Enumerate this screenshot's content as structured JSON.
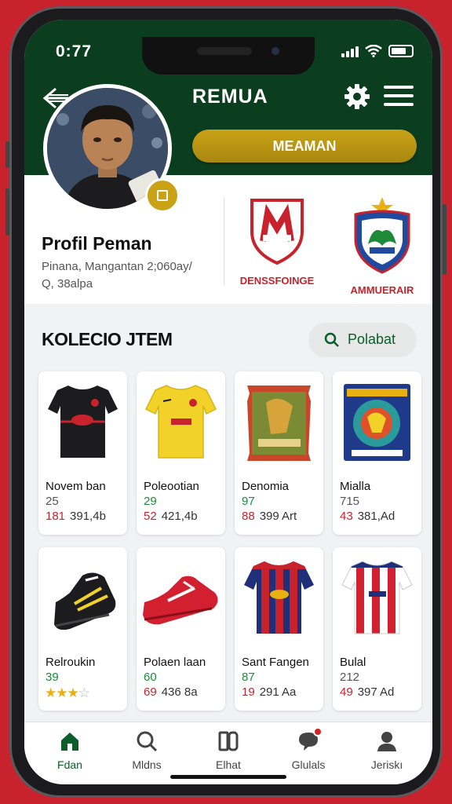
{
  "status_bar": {
    "time": "0:77"
  },
  "header": {
    "title": "REMUA",
    "cta_label": "MEAMAN"
  },
  "profile": {
    "name": "Profil Peman",
    "meta_line1": "Pinana, Mangantan 2;060ay/",
    "meta_line2": "Q, 38alpa",
    "clubs": [
      {
        "label": "DENSSFOINGE",
        "emblem": "red-shield-crest"
      },
      {
        "label": "AMMUERAIR",
        "emblem": "blue-shield-crest"
      }
    ]
  },
  "collection": {
    "title": "KOLECIO JTEM",
    "search_label": "Polabat",
    "items": [
      {
        "name": "Novem ban",
        "number": "25",
        "price_red": "181",
        "price": "391,4b",
        "icon": "black-jersey"
      },
      {
        "name": "Poleootian",
        "number": "29",
        "price_red": "52",
        "price": "421,4b",
        "icon": "yellow-jersey"
      },
      {
        "name": "Denomia",
        "number": "97",
        "price_red": "88",
        "price": "399 Art",
        "icon": "snack-pack"
      },
      {
        "name": "Mialla",
        "number": "715",
        "price_red": "43",
        "price": "381,Ad",
        "icon": "sticker-pack"
      },
      {
        "name": "Relroukin",
        "number": "39",
        "rating": 3,
        "icon": "black-boot"
      },
      {
        "name": "Polaen laan",
        "number": "60",
        "price_red": "69",
        "price": "436 8a",
        "icon": "red-boot"
      },
      {
        "name": "Sant Fangen",
        "number": "87",
        "price_red": "19",
        "price": "291 Aa",
        "icon": "striped-jersey"
      },
      {
        "name": "Bulal",
        "number": "212",
        "price_red": "49",
        "price": "397 Ad",
        "icon": "red-white-jersey"
      }
    ]
  },
  "bottom_nav": [
    {
      "label": "Fdan",
      "icon": "home-icon"
    },
    {
      "label": "Mldns",
      "icon": "search-icon"
    },
    {
      "label": "Elhat",
      "icon": "cards-icon"
    },
    {
      "label": "Glulals",
      "icon": "chat-icon"
    },
    {
      "label": "Jeriskı",
      "icon": "user-icon"
    }
  ],
  "colors": {
    "header_green": "#0b3d1f",
    "gold": "#c9a216",
    "accent_red": "#c8232c",
    "nav_active": "#0b5d2a"
  }
}
